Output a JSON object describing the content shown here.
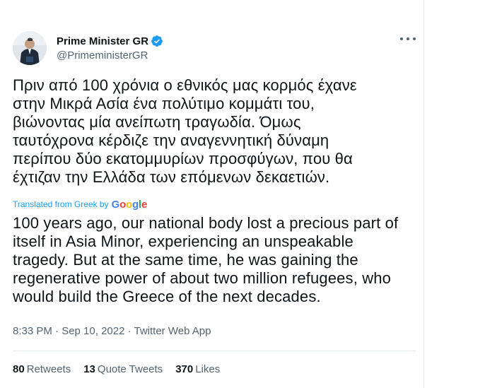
{
  "author": {
    "name": "Prime Minister GR",
    "handle": "@PrimeministerGR",
    "verified_color": "#1d9bf0"
  },
  "tweet": {
    "greek_lines": [
      "Πριν από 100 χρόνια ο εθνικός μας κορμός έχανε",
      "στην Μικρά Ασία ένα πολύτιμο κομμάτι του,",
      "βιώνοντας μία ανείπωτη τραγωδία. Όμως",
      "ταυτόχρονα κέρδιζε την αναγεννητική δύναμη",
      "περίπου δύο εκατομμυρίων προσφύγων, που θα",
      "έχτιζαν την Ελλάδα των επόμενων δεκαετιών."
    ],
    "translated_label": "Translated from Greek by",
    "translation_provider": "Google",
    "english_lines": [
      "100 years ago, our national body lost a precious part of",
      "itself in Asia Minor, experiencing an unspeakable",
      "tragedy. But at the same time, he was gaining the",
      "regenerative power of about two million refugees, who",
      "would build the Greece of the next decades."
    ],
    "timestamp": "8:33 PM · Sep 10, 2022 · Twitter Web App"
  },
  "stats": {
    "retweets_count": "80",
    "retweets_label": "Retweets",
    "quotes_count": "13",
    "quotes_label": "Quote Tweets",
    "likes_count": "370",
    "likes_label": "Likes"
  },
  "icons": {
    "more": "more-options-icon",
    "verified": "verified-badge-icon"
  }
}
